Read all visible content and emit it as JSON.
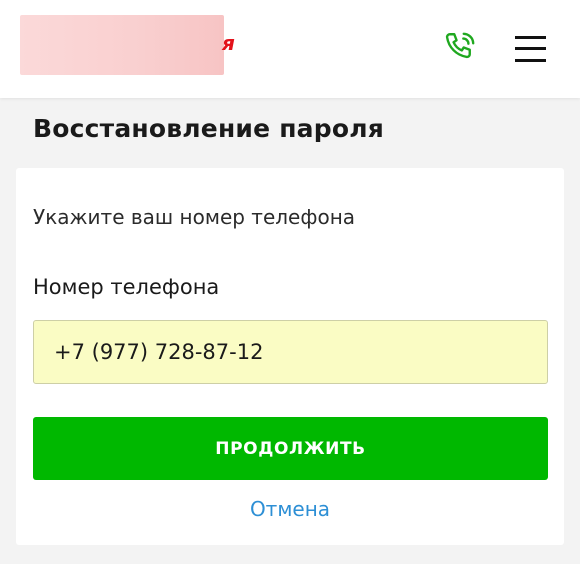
{
  "header": {
    "logo_tail": "я",
    "phone_icon": "phone-ringing-icon",
    "menu_icon": "hamburger-menu-icon",
    "accent_color": "#00b800"
  },
  "page": {
    "title": "Восстановление пароля"
  },
  "form": {
    "hint": "Укажите ваш номер телефона",
    "phone_label": "Номер телефона",
    "phone_value": "+7 (977) 728-87-12",
    "continue_label": "ПРОДОЛЖИТЬ",
    "cancel_label": "Отмена"
  }
}
